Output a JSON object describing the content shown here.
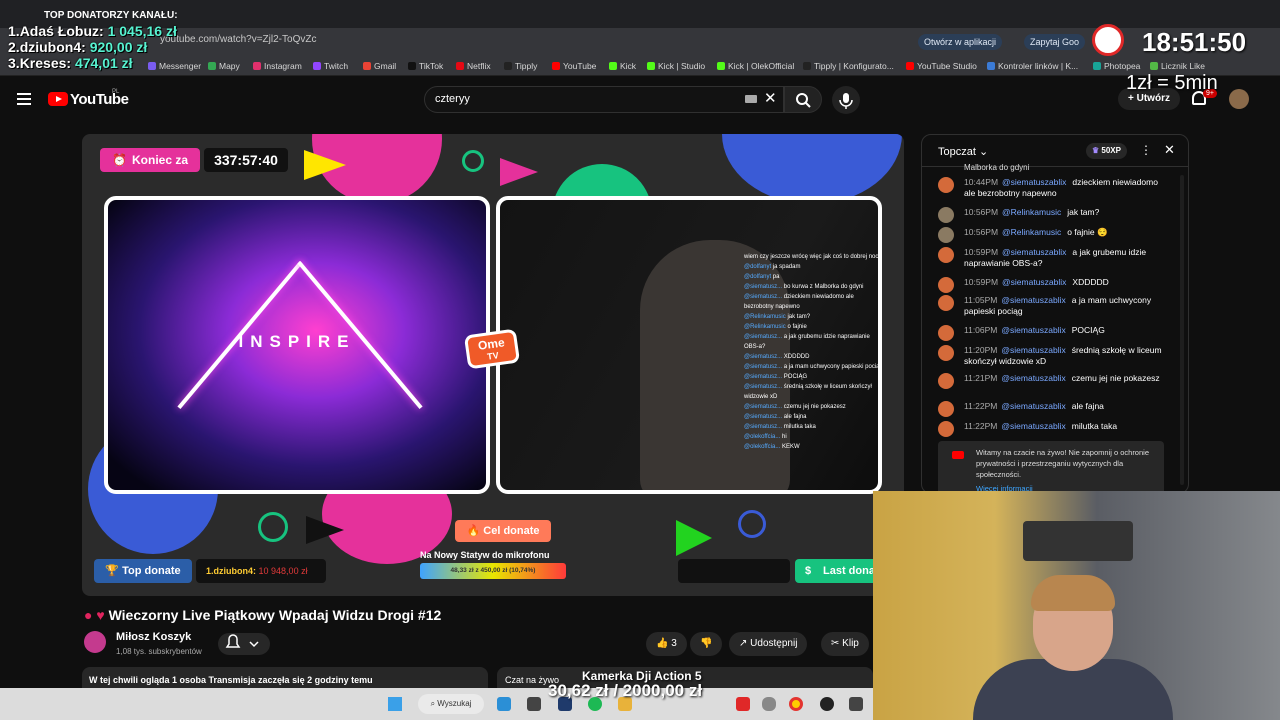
{
  "browser": {
    "url": "youtube.com/watch?v=Zjl2-ToQvZc",
    "open_in_app": "Otwórz w aplikacji",
    "ask_google": "Zapytaj Goo"
  },
  "bookmarks": [
    {
      "label": "Messenger",
      "color": "#7a5cf0"
    },
    {
      "label": "Mapy",
      "color": "#34a853"
    },
    {
      "label": "Instagram",
      "color": "#e1306c"
    },
    {
      "label": "Twitch",
      "color": "#9146ff"
    },
    {
      "label": "Gmail",
      "color": "#ea4335"
    },
    {
      "label": "TikTok",
      "color": "#111111"
    },
    {
      "label": "Netflix",
      "color": "#e50914"
    },
    {
      "label": "Tipply",
      "color": "#222222"
    },
    {
      "label": "YouTube",
      "color": "#ff0000"
    },
    {
      "label": "Kick",
      "color": "#53fc18"
    },
    {
      "label": "Kick | Studio",
      "color": "#53fc18"
    },
    {
      "label": "Kick | OlekOfficial",
      "color": "#53fc18"
    },
    {
      "label": "Tipply | Konfigurato...",
      "color": "#222222"
    },
    {
      "label": "YouTube Studio",
      "color": "#ff0000"
    },
    {
      "label": "Kontroler linków | K...",
      "color": "#3b7bd6"
    },
    {
      "label": "Photopea",
      "color": "#18a497"
    },
    {
      "label": "Licznik Like",
      "color": "#53b846"
    }
  ],
  "donors": {
    "header": "TOP DONATORZY KANAŁU:",
    "list": [
      {
        "rank": "1.",
        "name": "Adaś Łobuz:",
        "amount": "1 045,16 zł"
      },
      {
        "rank": "2.",
        "name": "dziubon4:",
        "amount": "920,00 zł"
      },
      {
        "rank": "3.",
        "name": "Kreses:",
        "amount": "474,01 zł"
      }
    ]
  },
  "overlay": {
    "clock": "18:51:50",
    "rate": "1zł = 5min"
  },
  "youtube": {
    "logo": "YouTube",
    "logo_region": "PL",
    "search_value": "czteryy",
    "create_label": "Utwórz",
    "notif_badge": "9+"
  },
  "player": {
    "koniec_label": "Koniec za",
    "timer": "337:57:40",
    "inspire": "INSPIRE",
    "ome": "Ome",
    "tv": "TV",
    "cel_label": "Cel donate",
    "goal_title": "Na Nowy Statyw do mikrofonu",
    "goal_value": "48,33 zł z 450,00 zł (10,74%)",
    "goal_fraction": 0.1074,
    "top_donate_label": "Top donate",
    "top_rank": "1.",
    "top_name": "dziubon4:",
    "top_amount": "10 948,00 zł",
    "last_donate_label": "Last dona",
    "stream_chat": [
      {
        "user": "",
        "text": "wiem czy jeszcze wrócę więc jak coś to dobrej nocki"
      },
      {
        "user": "@dolfanyt",
        "text": "ja spadam"
      },
      {
        "user": "@dolfanyt",
        "text": "pa"
      },
      {
        "user": "@siematusz...",
        "text": "bo kurwa z Malborka do gdyni"
      },
      {
        "user": "@siematusz...",
        "text": "dzieckiem niewiadomo ale bezrobotny napewno"
      },
      {
        "user": "@Relinkamusic",
        "text": "jak tam?"
      },
      {
        "user": "@Relinkamusic",
        "text": "o fajnie"
      },
      {
        "user": "@siematusz...",
        "text": "a jak grubemu idzie naprawianie OBS-a?"
      },
      {
        "user": "@siematusz...",
        "text": "XDDDDD"
      },
      {
        "user": "@siematusz...",
        "text": "a ja mam uchwycony papieski pociąg"
      },
      {
        "user": "@siematusz...",
        "text": "POCIĄG"
      },
      {
        "user": "@siematusz...",
        "text": "średnią szkołę w liceum skończył widzowie xD"
      },
      {
        "user": "@siematusz...",
        "text": "czemu jej nie pokazesz"
      },
      {
        "user": "@siematusz...",
        "text": "ale fajna"
      },
      {
        "user": "@siematusz...",
        "text": "milutka taka"
      },
      {
        "user": "@olekoffcia...",
        "text": "hi"
      },
      {
        "user": "@olekoffcia...",
        "text": "KEKW"
      }
    ]
  },
  "video": {
    "title": "Wieczorny Live Piątkowy Wpadaj Widzu Drogi #12",
    "channel": "Miłosz Koszyk",
    "subs": "1,08 tys. subskrybentów",
    "likes": "3",
    "share_label": "Udostępnij",
    "clip_label": "Klip",
    "desc": "W tej chwili ogląda 1 osoba  Transmisja zaczęła się 2 godziny temu",
    "live_chat_label": "Czat na żywo"
  },
  "chat": {
    "header": "Topczat",
    "xp": "50XP",
    "cut_text": "Malborka do gdyni",
    "messages": [
      {
        "time": "10:44PM",
        "author": "@siematuszablix",
        "text": "dzieckiem niewiadomo ale bezrobotny napewno",
        "avatar": "#d46a3a"
      },
      {
        "time": "10:56PM",
        "author": "@Relinkamusic",
        "text": "jak tam?",
        "avatar": "#8a7a62"
      },
      {
        "time": "10:56PM",
        "author": "@Relinkamusic",
        "text": "o fajnie 😌",
        "avatar": "#8a7a62"
      },
      {
        "time": "10:59PM",
        "author": "@siematuszablix",
        "text": "a jak grubemu idzie naprawianie OBS-a?",
        "avatar": "#d46a3a"
      },
      {
        "time": "10:59PM",
        "author": "@siematuszablix",
        "text": "XDDDDD",
        "avatar": "#d46a3a"
      },
      {
        "time": "11:05PM",
        "author": "@siematuszablix",
        "text": "a ja mam uchwycony papieski pociąg",
        "avatar": "#d46a3a"
      },
      {
        "time": "11:06PM",
        "author": "@siematuszablix",
        "text": "POCIĄG",
        "avatar": "#d46a3a"
      },
      {
        "time": "11:20PM",
        "author": "@siematuszablix",
        "text": "średnią szkołę w liceum skończył widzowie xD",
        "avatar": "#d46a3a"
      },
      {
        "time": "11:21PM",
        "author": "@siematuszablix",
        "text": "czemu jej nie pokazesz",
        "avatar": "#d46a3a"
      },
      {
        "time": "11:22PM",
        "author": "@siematuszablix",
        "text": "ale fajna",
        "avatar": "#d46a3a"
      },
      {
        "time": "11:22PM",
        "author": "@siematuszablix",
        "text": "milutka taka",
        "avatar": "#d46a3a"
      }
    ],
    "welcome": "Witamy na czacie na żywo! Nie zapomnij o ochronie prywatności i przestrzeganiu wytycznych dla społeczności.",
    "more_info": "Więcej informacji"
  },
  "taskbar": {
    "search_label": "Wyszukaj",
    "cam_label": "Kamerka Dji Action 5",
    "cam_amount": "30,62 zł / 2000,00 zł"
  },
  "colors": {
    "accent_pink": "#e5319b",
    "accent_green": "#17c37f",
    "donor_amount": "#57f3d1"
  }
}
